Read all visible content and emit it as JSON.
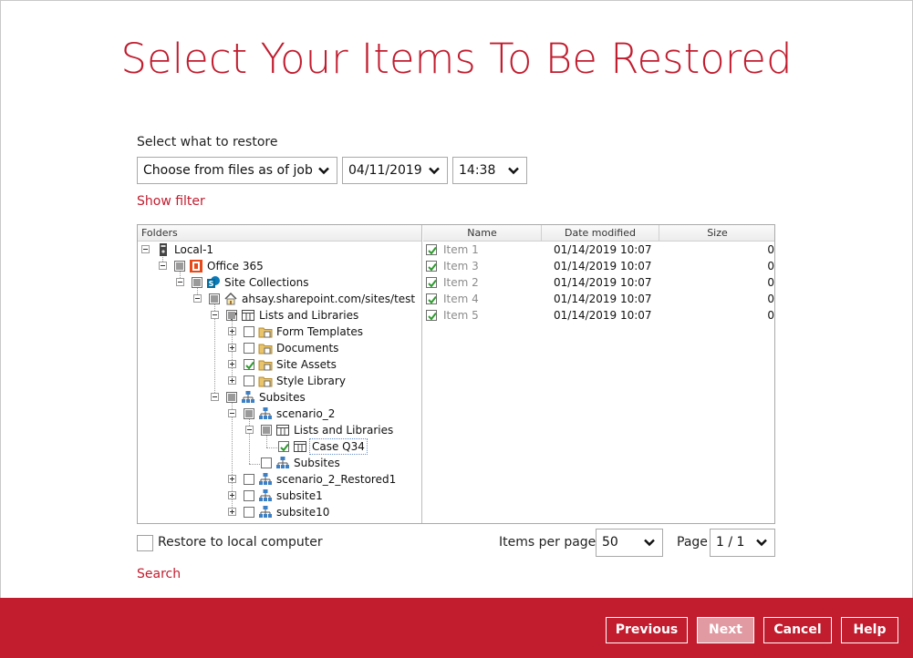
{
  "title": "Select Your Items To Be Restored",
  "select_label": "Select what to restore",
  "mode_select": {
    "value": "Choose from files as of job"
  },
  "date_select": {
    "value": "04/11/2019"
  },
  "time_select": {
    "value": "14:38"
  },
  "show_filter": "Show filter",
  "tree": {
    "header": "Folders",
    "nodes": {
      "local": "Local-1",
      "office365": "Office 365",
      "site_collections": "Site Collections",
      "site": "ahsay.sharepoint.com/sites/test",
      "lists_libraries": "Lists and Libraries",
      "form_templates": "Form Templates",
      "documents": "Documents",
      "site_assets": "Site Assets",
      "style_library": "Style Library",
      "subsites": "Subsites",
      "scenario_2": "scenario_2",
      "scenario_lists": "Lists and Libraries",
      "case_q34": "Case Q34",
      "scenario_subsites": "Subsites",
      "scenario_2_restored": "scenario_2_Restored1",
      "subsite1": "subsite1",
      "subsite10": "subsite10"
    }
  },
  "list": {
    "columns": {
      "name": "Name",
      "date": "Date modified",
      "size": "Size"
    },
    "rows": [
      {
        "name": "Item 1",
        "date": "01/14/2019 10:07",
        "size": "0"
      },
      {
        "name": "Item 3",
        "date": "01/14/2019 10:07",
        "size": "0"
      },
      {
        "name": "Item 2",
        "date": "01/14/2019 10:07",
        "size": "0"
      },
      {
        "name": "Item 4",
        "date": "01/14/2019 10:07",
        "size": "0"
      },
      {
        "name": "Item 5",
        "date": "01/14/2019 10:07",
        "size": "0"
      }
    ]
  },
  "restore_local": "Restore to local computer",
  "items_per_page_label": "Items per page",
  "items_per_page_value": "50",
  "page_label": "Page",
  "page_value": "1 / 1",
  "search_link": "Search",
  "buttons": {
    "previous": "Previous",
    "next": "Next",
    "cancel": "Cancel",
    "help": "Help"
  },
  "colors": {
    "accent": "#c11d2f",
    "disabled_button": "#e19aa2",
    "check": "#2e9a2e"
  },
  "icons": {
    "server": "server-icon",
    "office": "office365-icon",
    "sharepoint": "sharepoint-icon",
    "home": "home-icon",
    "list": "list-icon",
    "folder": "folder-icon",
    "sitemap": "sitemap-icon"
  }
}
